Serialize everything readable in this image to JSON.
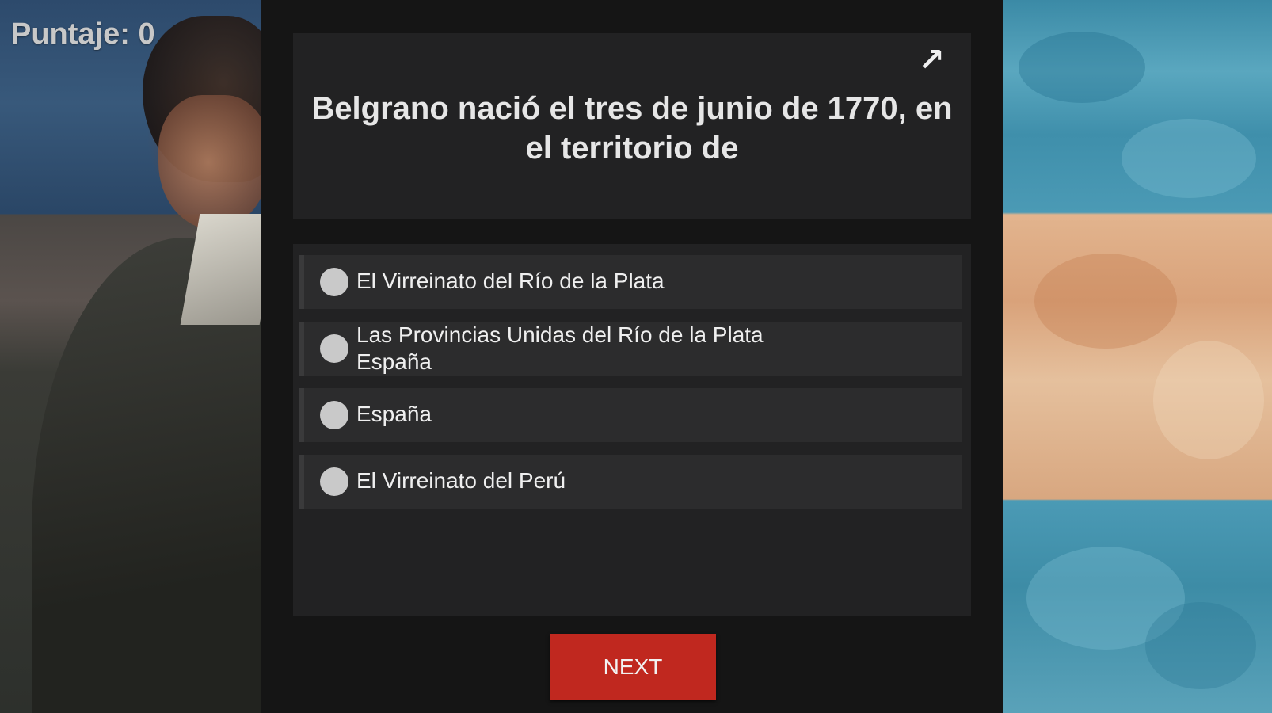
{
  "score": {
    "text": "Puntaje: 0"
  },
  "question": {
    "text": "Belgrano nació el tres de junio de 1770, en el territorio de",
    "back_icon": "arrow-back-icon"
  },
  "options": [
    {
      "label": "El Virreinato del Río de la Plata"
    },
    {
      "label": "Las Provincias Unidas del Río de la Plata\nEspaña"
    },
    {
      "label": "España"
    },
    {
      "label": "El Virreinato del Perú"
    }
  ],
  "next_button": {
    "label": "NEXT"
  },
  "colors": {
    "panel_bg": "#151515",
    "card_bg": "#222223",
    "option_bg": "#2c2c2d",
    "radio": "#c9c9c9",
    "next_button": "#c0281f",
    "text": "#efefef"
  }
}
